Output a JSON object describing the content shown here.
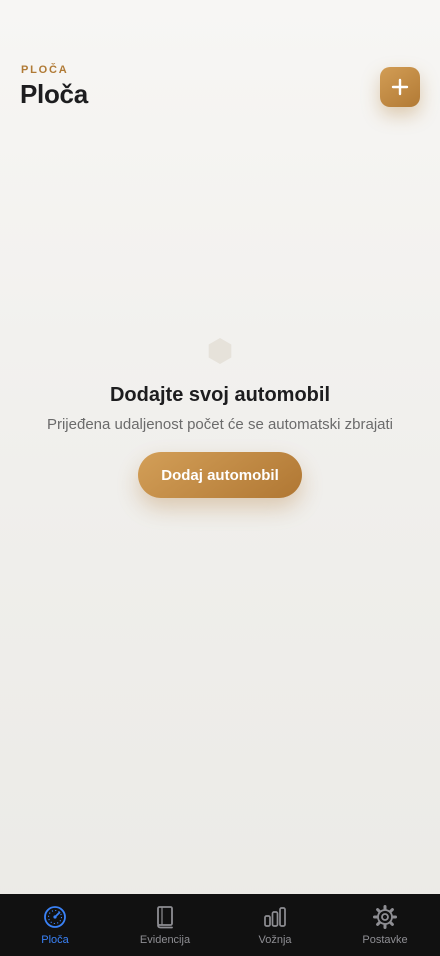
{
  "header": {
    "overline": "PLOČA",
    "title": "Ploča",
    "add_button_icon": "plus-icon"
  },
  "empty_state": {
    "icon": "hexagon-icon",
    "title": "Dodajte svoj automobil",
    "subtitle": "Prijeđena udaljenost počet će se automatski zbrajati",
    "cta_label": "Dodaj automobil"
  },
  "tabbar": {
    "active_index": 0,
    "items": [
      {
        "label": "Ploča",
        "icon": "speedometer-icon"
      },
      {
        "label": "Evidencija",
        "icon": "book-icon"
      },
      {
        "label": "Vožnja",
        "icon": "bar-chart-icon"
      },
      {
        "label": "Postavke",
        "icon": "gear-icon"
      }
    ]
  },
  "colors": {
    "accent": "#b07a35",
    "accent_light": "#d29d55",
    "active_tab": "#3a82f7",
    "inactive_tab": "#8e8e93",
    "tabbar_bg": "#111111"
  }
}
